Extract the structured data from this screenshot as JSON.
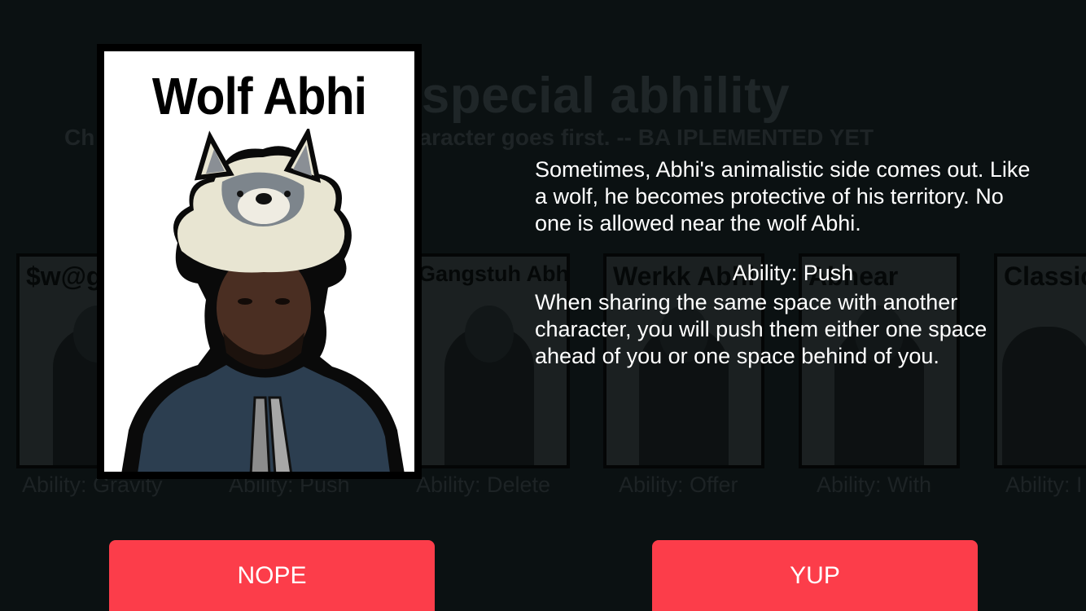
{
  "background": {
    "title": "your special abhility",
    "instructions": "Ch                                   om left to right. I.e, the left character goes first. -- BA                                   IPLEMENTED YET",
    "cards": [
      {
        "name": "$w@g",
        "ability": "Ability: Gravity"
      },
      {
        "name": "",
        "ability": "Ability: Push"
      },
      {
        "name": "Gangstuh Abhi",
        "ability": "Ability: Delete"
      },
      {
        "name": "Werkk Abhi",
        "ability": "Ability: Offer"
      },
      {
        "name": "Abhear",
        "ability": "Ability: With"
      },
      {
        "name": "Classic",
        "ability": "Ability: I"
      }
    ]
  },
  "selected": {
    "name": "Wolf Abhi",
    "description": "Sometimes, Abhi's animalistic side comes out. Like a wolf, he becomes protective of his territory. No one is allowed near the wolf Abhi.",
    "ability_title": "Ability: Push",
    "ability_description": "When sharing the same space with another character, you will push them either one space ahead of you or one space behind of you."
  },
  "buttons": {
    "nope": "NOPE",
    "yup": "YUP"
  },
  "colors": {
    "background": "#0b1112",
    "button": "#fc3d4a",
    "text": "#ffffff"
  }
}
